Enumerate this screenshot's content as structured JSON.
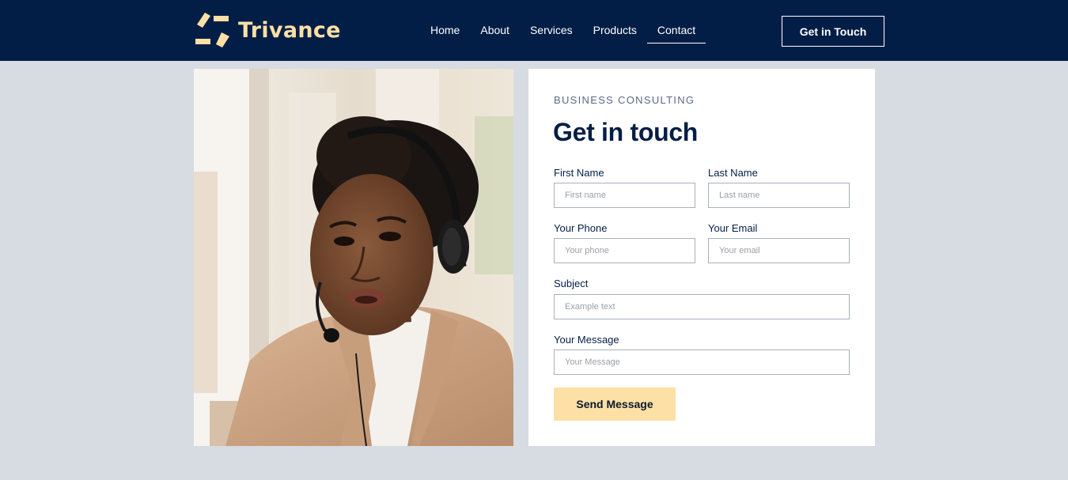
{
  "brand": {
    "name": "Trivance",
    "color": "#fde0a6"
  },
  "nav": {
    "items": [
      {
        "label": "Home",
        "active": false
      },
      {
        "label": "About",
        "active": false
      },
      {
        "label": "Services",
        "active": false
      },
      {
        "label": "Products",
        "active": false
      },
      {
        "label": "Contact",
        "active": true
      }
    ],
    "cta_label": "Get in Touch"
  },
  "hero_image": {
    "icon": "photo-woman-headset"
  },
  "form": {
    "eyebrow": "BUSINESS CONSULTING",
    "title": "Get in touch",
    "fields": {
      "first_name": {
        "label": "First Name",
        "placeholder": "First name",
        "value": ""
      },
      "last_name": {
        "label": "Last Name",
        "placeholder": "Last name",
        "value": ""
      },
      "phone": {
        "label": "Your Phone",
        "placeholder": "Your phone",
        "value": ""
      },
      "email": {
        "label": "Your Email",
        "placeholder": "Your email",
        "value": ""
      },
      "subject": {
        "label": "Subject",
        "placeholder": "Example text",
        "value": ""
      },
      "message": {
        "label": "Your Message",
        "placeholder": "Your Message",
        "value": ""
      }
    },
    "submit_label": "Send Message"
  },
  "colors": {
    "header_bg": "#031e46",
    "page_bg": "#d7dbe2",
    "accent": "#fde0a6",
    "heading": "#031e46"
  }
}
